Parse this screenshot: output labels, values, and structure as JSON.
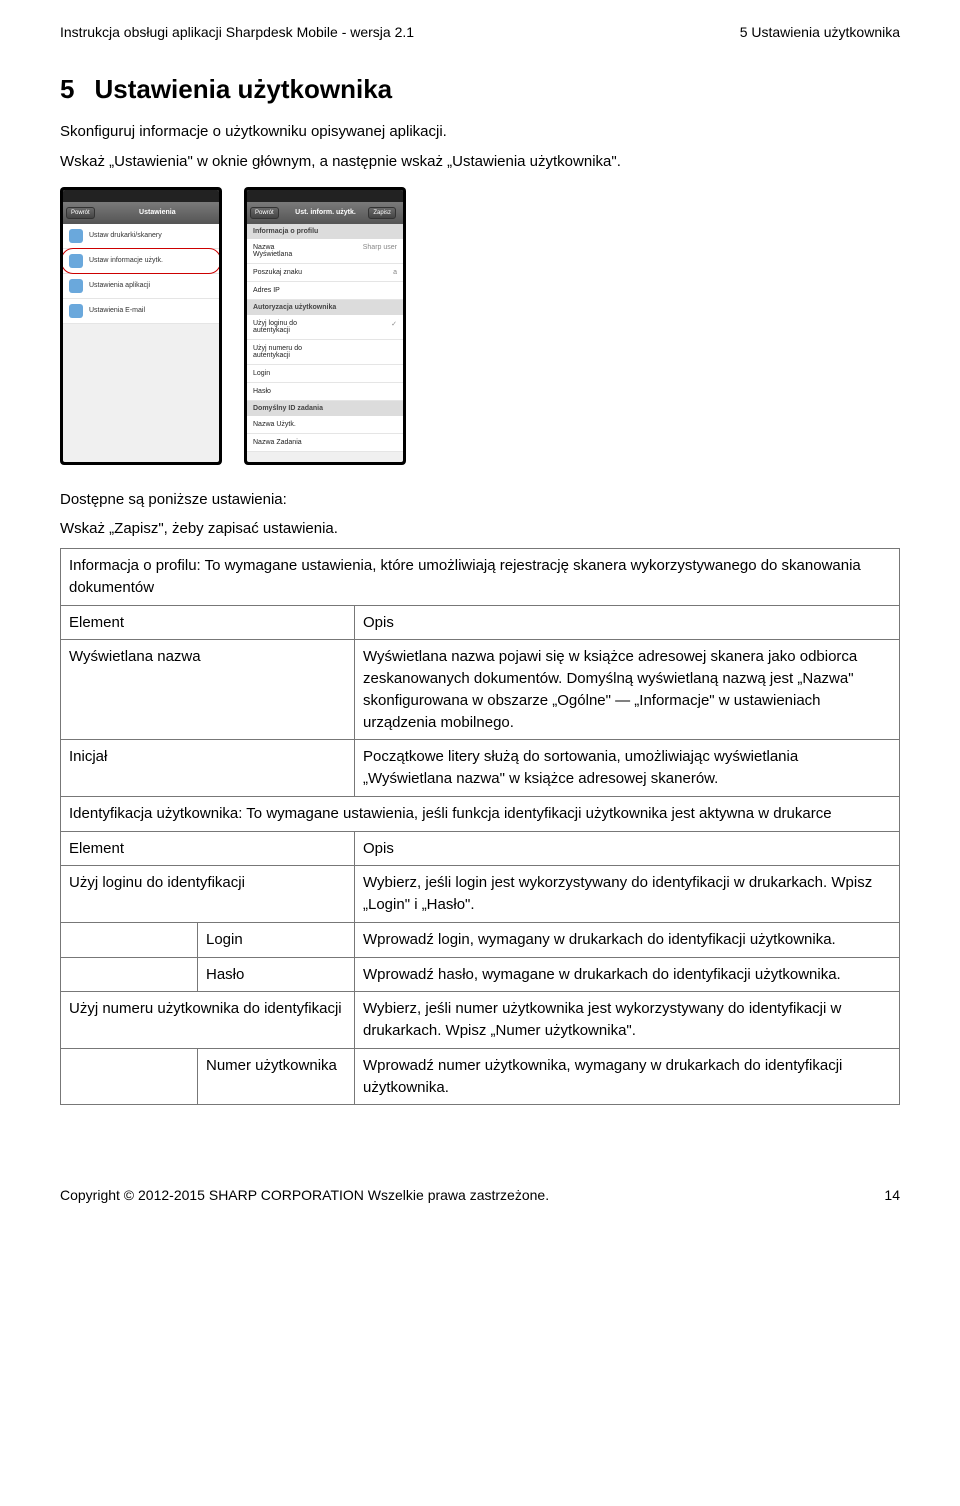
{
  "header": {
    "left": "Instrukcja obsługi aplikacji Sharpdesk Mobile - wersja 2.1",
    "right": "5 Ustawienia użytkownika"
  },
  "section_num": "5",
  "section_title": "Ustawienia użytkownika",
  "intro_p1": "Skonfiguruj informacje o użytkowniku opisywanej aplikacji.",
  "intro_p2": "Wskaż „Ustawienia\" w oknie głównym, a następnie wskaż „Ustawienia użytkownika\".",
  "phone1": {
    "back": "Powrót",
    "title": "Ustawienia",
    "rows": [
      "Ustaw drukarki/skanery",
      "Ustaw informacje użytk.",
      "Ustawienia aplikacji",
      "Ustawienia E-mail"
    ]
  },
  "phone2": {
    "back": "Powrót",
    "title": "Ust. inform. użytk.",
    "save": "Zapisz",
    "sect_profile": "Informacja o profilu",
    "rows_profile": [
      {
        "k": "Nazwa Wyświetlana",
        "v": "Sharp user"
      },
      {
        "k": "Poszukaj znaku",
        "v": "a"
      },
      {
        "k": "Adres IP",
        "v": ""
      }
    ],
    "sect_auth": "Autoryzacja użytkownika",
    "rows_auth": [
      {
        "k": "Użyj loginu do autentykacji",
        "v": "✓"
      },
      {
        "k": "Użyj numeru do autentykacji",
        "v": ""
      },
      {
        "k": "Login",
        "v": ""
      },
      {
        "k": "Hasło",
        "v": ""
      }
    ],
    "sect_job": "Domyślny ID zadania",
    "rows_job": [
      {
        "k": "Nazwa Użytk.",
        "v": ""
      },
      {
        "k": "Nazwa Zadania",
        "v": ""
      }
    ]
  },
  "below_p1": "Dostępne są poniższe ustawienia:",
  "below_p2": "Wskaż „Zapisz\", żeby zapisać ustawienia.",
  "table1": {
    "head": "Informacja o profilu: To wymagane ustawienia, które umożliwiają rejestrację skanera wykorzystywanego do skanowania dokumentów",
    "col_el": "Element",
    "col_desc": "Opis",
    "r1_el": "Wyświetlana nazwa",
    "r1_desc": "Wyświetlana nazwa pojawi się w książce adresowej skanera jako odbiorca zeskanowanych dokumentów. Domyślną wyświetlaną nazwą jest „Nazwa\" skonfigurowana w obszarze „Ogólne\" — „Informacje\" w ustawieniach urządzenia mobilnego.",
    "r2_el": "Inicjał",
    "r2_desc": "Początkowe litery służą do sortowania, umożliwiając wyświetlania „Wyświetlana nazwa\" w książce adresowej skanerów."
  },
  "table2": {
    "head": "Identyfikacja użytkownika: To wymagane ustawienia, jeśli funkcja identyfikacji użytkownika jest aktywna w drukarce",
    "col_el": "Element",
    "col_desc": "Opis",
    "r1_el": "Użyj loginu do identyfikacji",
    "r1_desc": "Wybierz, jeśli login jest wykorzystywany do identyfikacji w drukarkach. Wpisz „Login\" i „Hasło\".",
    "r2_sub": "Login",
    "r2_desc": "Wprowadź login, wymagany w drukarkach do identyfikacji użytkownika.",
    "r3_sub": "Hasło",
    "r3_desc": "Wprowadź hasło, wymagane w drukarkach do identyfikacji użytkownika.",
    "r4_el": "Użyj numeru użytkownika do identyfikacji",
    "r4_desc": "Wybierz, jeśli numer użytkownika jest wykorzystywany do identyfikacji w drukarkach. Wpisz „Numer użytkownika\".",
    "r5_sub": "Numer użytkownika",
    "r5_desc": "Wprowadź numer użytkownika, wymagany w drukarkach do identyfikacji użytkownika."
  },
  "footer": {
    "left": "Copyright © 2012-2015 SHARP CORPORATION Wszelkie prawa zastrzeżone.",
    "right": "14"
  }
}
